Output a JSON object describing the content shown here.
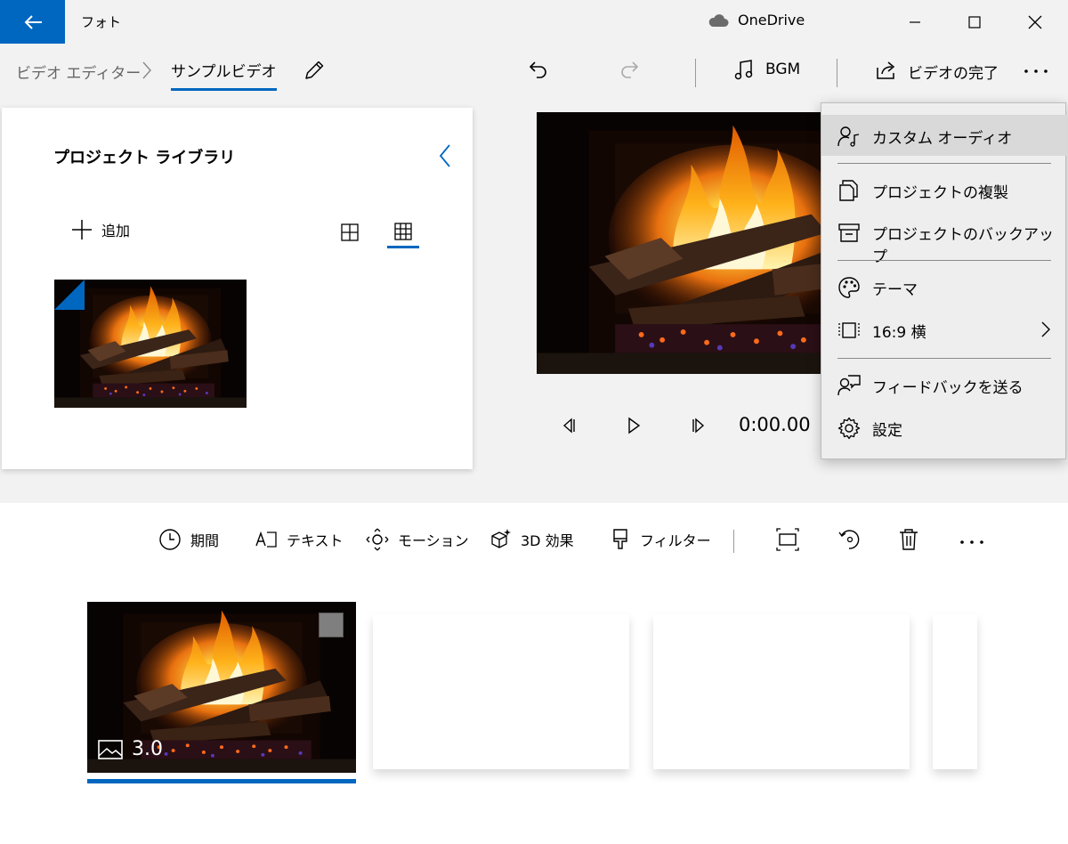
{
  "window": {
    "app_title": "フォト",
    "onedrive_label": "OneDrive"
  },
  "toolbar": {
    "breadcrumb_root": "ビデオ エディター",
    "breadcrumb_current": "サンプルビデオ",
    "bgm_label": "BGM",
    "finish_label": "ビデオの完了"
  },
  "library": {
    "title": "プロジェクト ライブラリ",
    "add_label": "追加"
  },
  "preview": {
    "time": "0:00.00"
  },
  "storyboard": {
    "tools": {
      "duration": "期間",
      "text": "テキスト",
      "motion": "モーション",
      "effects3d": "3D 効果",
      "filters": "フィルター"
    },
    "clips": [
      {
        "duration": "3.0"
      }
    ]
  },
  "menu": {
    "items": [
      {
        "label": "カスタム オーディオ",
        "icon": "custom-audio-icon"
      },
      {
        "label": "プロジェクトの複製",
        "icon": "duplicate-icon"
      },
      {
        "label": "プロジェクトのバックアップ",
        "icon": "archive-icon"
      },
      {
        "label": "テーマ",
        "icon": "palette-icon"
      },
      {
        "label": "16:9 横",
        "icon": "aspect-ratio-icon"
      },
      {
        "label": "フィードバックを送る",
        "icon": "feedback-icon"
      },
      {
        "label": "設定",
        "icon": "gear-icon"
      }
    ]
  },
  "colors": {
    "accent": "#0067c0"
  }
}
